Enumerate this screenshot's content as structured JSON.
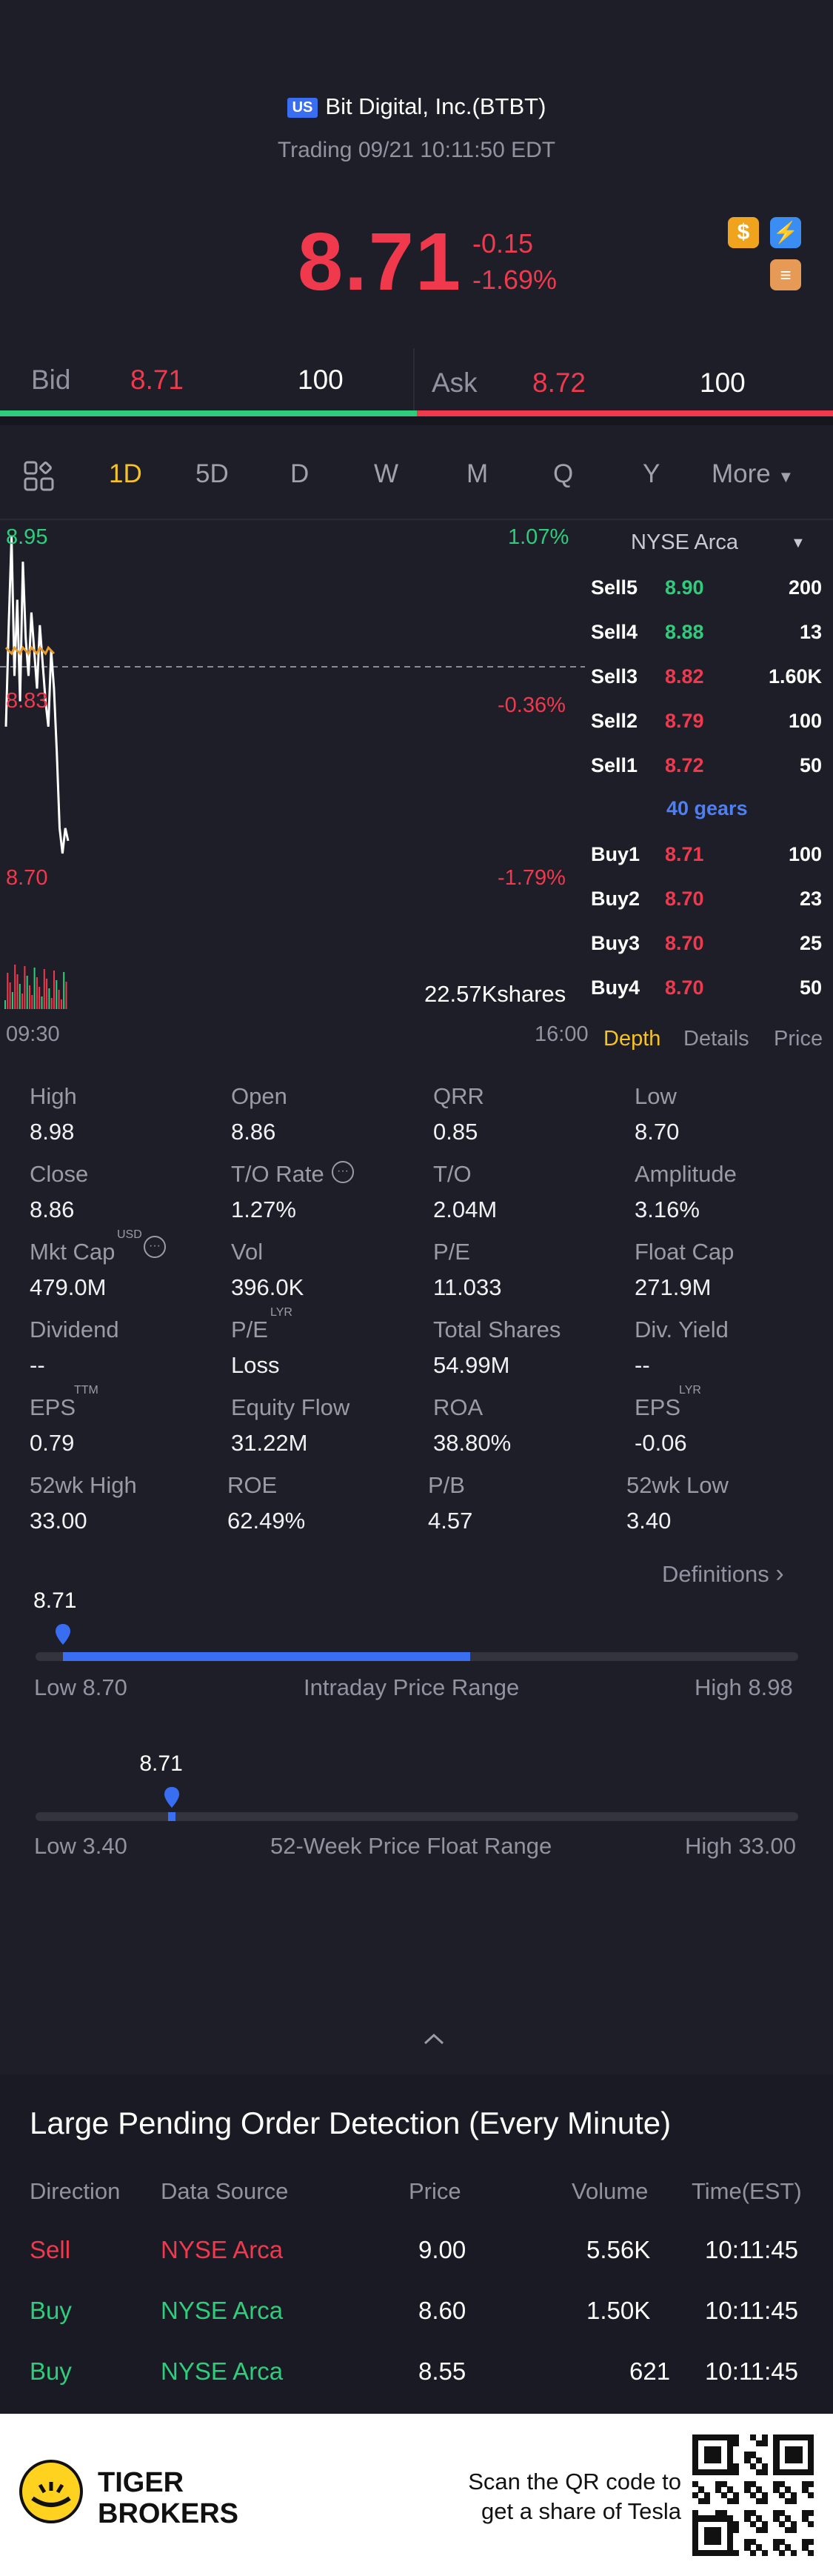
{
  "header": {
    "flag": "US",
    "company": "Bit Digital, Inc.(BTBT)",
    "status": "Trading 09/21 10:11:50 EDT",
    "price": "8.71",
    "change": "-0.15",
    "change_pct": "-1.69%"
  },
  "quote": {
    "bid_label": "Bid",
    "bid_price": "8.71",
    "bid_size": "100",
    "ask_label": "Ask",
    "ask_price": "8.72",
    "ask_size": "100",
    "bid_fraction": 0.5
  },
  "tabs": [
    "1D",
    "5D",
    "D",
    "W",
    "M",
    "Q",
    "Y",
    "More"
  ],
  "active_tab": "1D",
  "chart": {
    "high_label": "8.95",
    "high_pct": "1.07%",
    "mid_label": "8.83",
    "mid_pct": "-0.36%",
    "low_label": "8.70",
    "low_pct": "-1.79%",
    "volume": "22.57Kshares",
    "time_start": "09:30",
    "time_end": "16:00"
  },
  "chart_data": {
    "type": "line",
    "series": [
      {
        "values": [
          8.8,
          8.88,
          8.95,
          8.84,
          8.9,
          8.82,
          8.93,
          8.87,
          8.84,
          8.89,
          8.86,
          8.83,
          8.88,
          8.85,
          8.82,
          8.8,
          8.86,
          8.83,
          8.78,
          8.72,
          8.7,
          8.72,
          8.71
        ]
      }
    ],
    "ylim": [
      8.7,
      8.95
    ],
    "reference": 8.86,
    "xlabel": "",
    "ylabel": ""
  },
  "orderbook": {
    "exchange": "NYSE Arca",
    "sells": [
      {
        "label": "Sell5",
        "price": "8.90",
        "size": "200",
        "color": "#2fcd7b"
      },
      {
        "label": "Sell4",
        "price": "8.88",
        "size": "13",
        "color": "#2fcd7b"
      },
      {
        "label": "Sell3",
        "price": "8.82",
        "size": "1.60K",
        "color": "#f0394c"
      },
      {
        "label": "Sell2",
        "price": "8.79",
        "size": "100",
        "color": "#f0394c"
      },
      {
        "label": "Sell1",
        "price": "8.72",
        "size": "50",
        "color": "#f0394c"
      }
    ],
    "gears": "40 gears",
    "buys": [
      {
        "label": "Buy1",
        "price": "8.71",
        "size": "100",
        "color": "#f0394c"
      },
      {
        "label": "Buy2",
        "price": "8.70",
        "size": "23",
        "color": "#f0394c"
      },
      {
        "label": "Buy3",
        "price": "8.70",
        "size": "25",
        "color": "#f0394c"
      },
      {
        "label": "Buy4",
        "price": "8.70",
        "size": "50",
        "color": "#f0394c"
      }
    ],
    "tabs": [
      "Depth",
      "Details",
      "Price"
    ]
  },
  "stats": [
    {
      "label": "High",
      "value": "8.98"
    },
    {
      "label": "Open",
      "value": "8.86"
    },
    {
      "label": "QRR",
      "value": "0.85"
    },
    {
      "label": "Low",
      "value": "8.70"
    },
    {
      "label": "Close",
      "value": "8.86"
    },
    {
      "label": "T/O Rate",
      "value": "1.27%"
    },
    {
      "label": "T/O",
      "value": "2.04M"
    },
    {
      "label": "Amplitude",
      "value": "3.16%"
    },
    {
      "label": "Mkt Cap",
      "value": "479.0M",
      "sup": "USD"
    },
    {
      "label": "Vol",
      "value": "396.0K"
    },
    {
      "label": "P/E",
      "value": "11.033"
    },
    {
      "label": "Float Cap",
      "value": "271.9M"
    },
    {
      "label": "Dividend",
      "value": "--"
    },
    {
      "label": "P/E",
      "value": "Loss",
      "sup": "LYR"
    },
    {
      "label": "Total Shares",
      "value": "54.99M"
    },
    {
      "label": "Div. Yield",
      "value": "--"
    },
    {
      "label": "EPS",
      "value": "0.79",
      "sup": "TTM"
    },
    {
      "label": "Equity Flow",
      "value": "31.22M"
    },
    {
      "label": "ROA",
      "value": "38.80%"
    },
    {
      "label": "EPS",
      "value": "-0.06",
      "sup": "LYR"
    },
    {
      "label": "52wk High",
      "value": "33.00"
    },
    {
      "label": "ROE",
      "value": "62.49%"
    },
    {
      "label": "P/B",
      "value": "4.57"
    },
    {
      "label": "52wk Low",
      "value": "3.40"
    }
  ],
  "definitions_label": "Definitions",
  "intraday": {
    "marker": "8.71",
    "low": "Low 8.70",
    "title": "Intraday Price Range",
    "high": "High 8.98",
    "marker_fraction": 0.036,
    "fill_fraction": 0.57
  },
  "week52": {
    "marker": "8.71",
    "low": "Low 3.40",
    "title": "52-Week Price Float Range",
    "high": "High 33.00",
    "marker_fraction": 0.179
  },
  "pending": {
    "title": "Large Pending Order Detection (Every Minute)",
    "headers": [
      "Direction",
      "Data Source",
      "Price",
      "Volume",
      "Time(EST)"
    ],
    "rows": [
      {
        "direction": "Sell",
        "source": "NYSE Arca",
        "price": "9.00",
        "volume": "5.56K",
        "time": "10:11:45",
        "color": "#f0394c"
      },
      {
        "direction": "Buy",
        "source": "NYSE Arca",
        "price": "8.60",
        "volume": "1.50K",
        "time": "10:11:45",
        "color": "#2fcd7b"
      },
      {
        "direction": "Buy",
        "source": "NYSE Arca",
        "price": "8.55",
        "volume": "621",
        "time": "10:11:45",
        "color": "#2fcd7b"
      }
    ]
  },
  "footer": {
    "brand_line1": "TIGER",
    "brand_line2": "BROKERS",
    "scan_line1": "Scan the QR code to",
    "scan_line2": "get a share of Tesla"
  },
  "colors": {
    "red": "#f0394c",
    "green": "#2fcd7b",
    "accent_blue": "#3a6ef2",
    "tab_active": "#f5c324"
  }
}
